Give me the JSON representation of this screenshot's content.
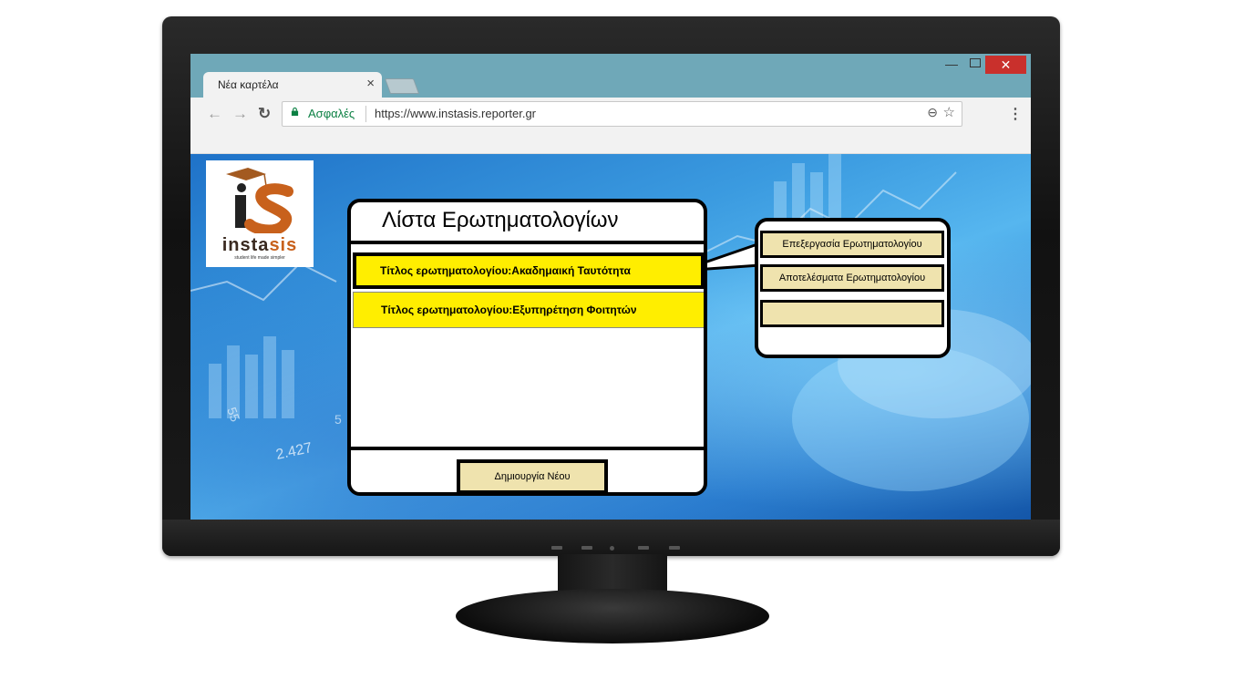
{
  "browser": {
    "tab_title": "Νέα καρτέλα",
    "tab_close": "×",
    "secure_label": "Ασφαλές",
    "url": "https://www.instasis.reporter.gr"
  },
  "logo": {
    "brand_start": "insta",
    "brand_end": "sis",
    "tagline": "student life made simpler",
    "accent_color": "#c8611c"
  },
  "panel": {
    "title": "Λίστα Ερωτηματολογίων",
    "items": [
      {
        "label": "Τίτλος ερωτηματολογίου:Ακαδημαική Ταυτότητα",
        "selected": true
      },
      {
        "label": "Τίτλος ερωτηματολογίου:Εξυπηρέτηση Φοιτητών",
        "selected": false
      }
    ],
    "create_button": "Δημιουργία Νέου",
    "item_color": "#ffee00"
  },
  "context_menu": {
    "items": [
      "Επεξεργασία Ερωτηματολογίου",
      "Αποτελέσματα Ερωτηματολογίου",
      ""
    ],
    "button_color": "#efe3ae"
  },
  "background": {
    "numbers": [
      "2.427",
      "5",
      "55"
    ]
  }
}
